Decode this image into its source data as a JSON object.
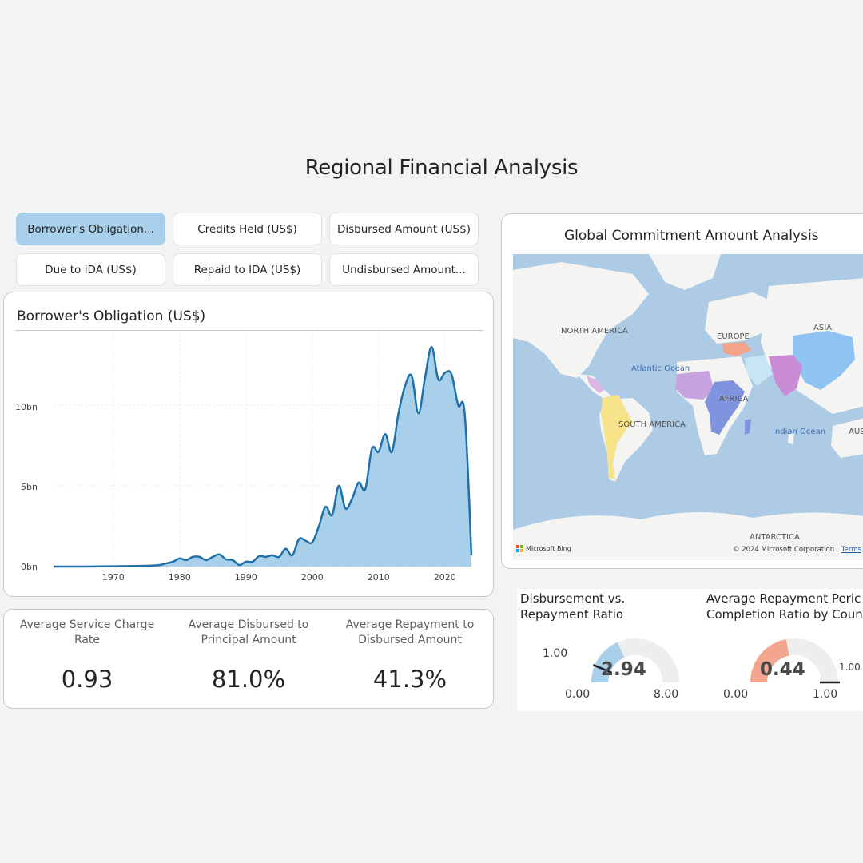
{
  "page_title": "Regional Financial Analysis",
  "slicers": [
    {
      "label": "Borrower's Obligation...",
      "active": true
    },
    {
      "label": "Credits Held (US$)",
      "active": false
    },
    {
      "label": "Disbursed Amount (US$)",
      "active": false
    },
    {
      "label": "Due to IDA (US$)",
      "active": false
    },
    {
      "label": "Repaid to IDA (US$)",
      "active": false
    },
    {
      "label": "Undisbursed Amount...",
      "active": false
    }
  ],
  "area_chart": {
    "title": "Borrower's Obligation (US$)",
    "y_ticks": [
      "0bn",
      "5bn",
      "10bn"
    ],
    "x_ticks": [
      "1970",
      "1980",
      "1990",
      "2000",
      "2010",
      "2020"
    ]
  },
  "chart_data": {
    "type": "area",
    "title": "Borrower's Obligation (US$)",
    "xlabel": "",
    "ylabel": "",
    "unit": "bn",
    "xlim": [
      1961,
      2024
    ],
    "ylim": [
      0,
      14.5
    ],
    "grid": true,
    "color": "#a9d0ea",
    "line_color": "#1f6fa8",
    "x": [
      1961,
      1965,
      1970,
      1975,
      1977,
      1978,
      1979,
      1980,
      1981,
      1982,
      1983,
      1984,
      1985,
      1986,
      1987,
      1988,
      1989,
      1990,
      1991,
      1992,
      1993,
      1994,
      1995,
      1996,
      1997,
      1998,
      1999,
      2000,
      2001,
      2002,
      2003,
      2004,
      2005,
      2006,
      2007,
      2008,
      2009,
      2010,
      2011,
      2012,
      2013,
      2014,
      2015,
      2016,
      2017,
      2018,
      2019,
      2020,
      2021,
      2022,
      2023,
      2024
    ],
    "y": [
      0,
      0,
      0.02,
      0.05,
      0.1,
      0.2,
      0.3,
      0.5,
      0.4,
      0.6,
      0.6,
      0.4,
      0.6,
      0.75,
      0.45,
      0.4,
      0.1,
      0.3,
      0.3,
      0.65,
      0.6,
      0.7,
      0.6,
      1.1,
      0.7,
      1.7,
      1.6,
      1.5,
      2.5,
      3.7,
      3.2,
      5.0,
      3.6,
      4.2,
      5.2,
      4.8,
      7.3,
      7.1,
      8.2,
      7.1,
      9.5,
      11.2,
      11.8,
      9.5,
      11.7,
      13.6,
      11.6,
      12.0,
      11.9,
      10.0,
      9.4,
      0.7
    ]
  },
  "kpis": [
    {
      "label": "Average Service Charge Rate",
      "value": "0.93"
    },
    {
      "label": "Average Disbursed to Principal Amount",
      "value": "81.0%"
    },
    {
      "label": "Average Repayment to Disbursed Amount",
      "value": "41.3%"
    }
  ],
  "map": {
    "title": "Global Commitment Amount Analysis",
    "labels": {
      "north_america": "NORTH AMERICA",
      "europe": "EUROPE",
      "asia": "ASIA",
      "africa": "AFRICA",
      "south_america": "SOUTH AMERICA",
      "antarctica": "ANTARCTICA",
      "australia": "AUS",
      "atlantic": "Atlantic Ocean",
      "indian": "Indian Ocean"
    },
    "logo": "Microsoft Bing",
    "copyright": "© 2024 Microsoft Corporation",
    "terms": "Terms"
  },
  "gauges": [
    {
      "title_line1": "Disbursement vs.",
      "title_line2": "Repayment Ratio",
      "value": "2.94",
      "min": "0.00",
      "max": "8.00",
      "target": "1.00",
      "value_num": 2.94,
      "min_num": 0,
      "max_num": 8,
      "target_num": 1.0,
      "fill": "#a9d0ea"
    },
    {
      "title_line1": "Average Repayment Peric",
      "title_line2": "Completion Ratio by Coun",
      "value": "0.44",
      "min": "0.00",
      "max": "1.00",
      "target": "1.00",
      "value_num": 0.44,
      "min_num": 0,
      "max_num": 1,
      "target_num": 1.0,
      "fill": "#f4a58f"
    }
  ]
}
